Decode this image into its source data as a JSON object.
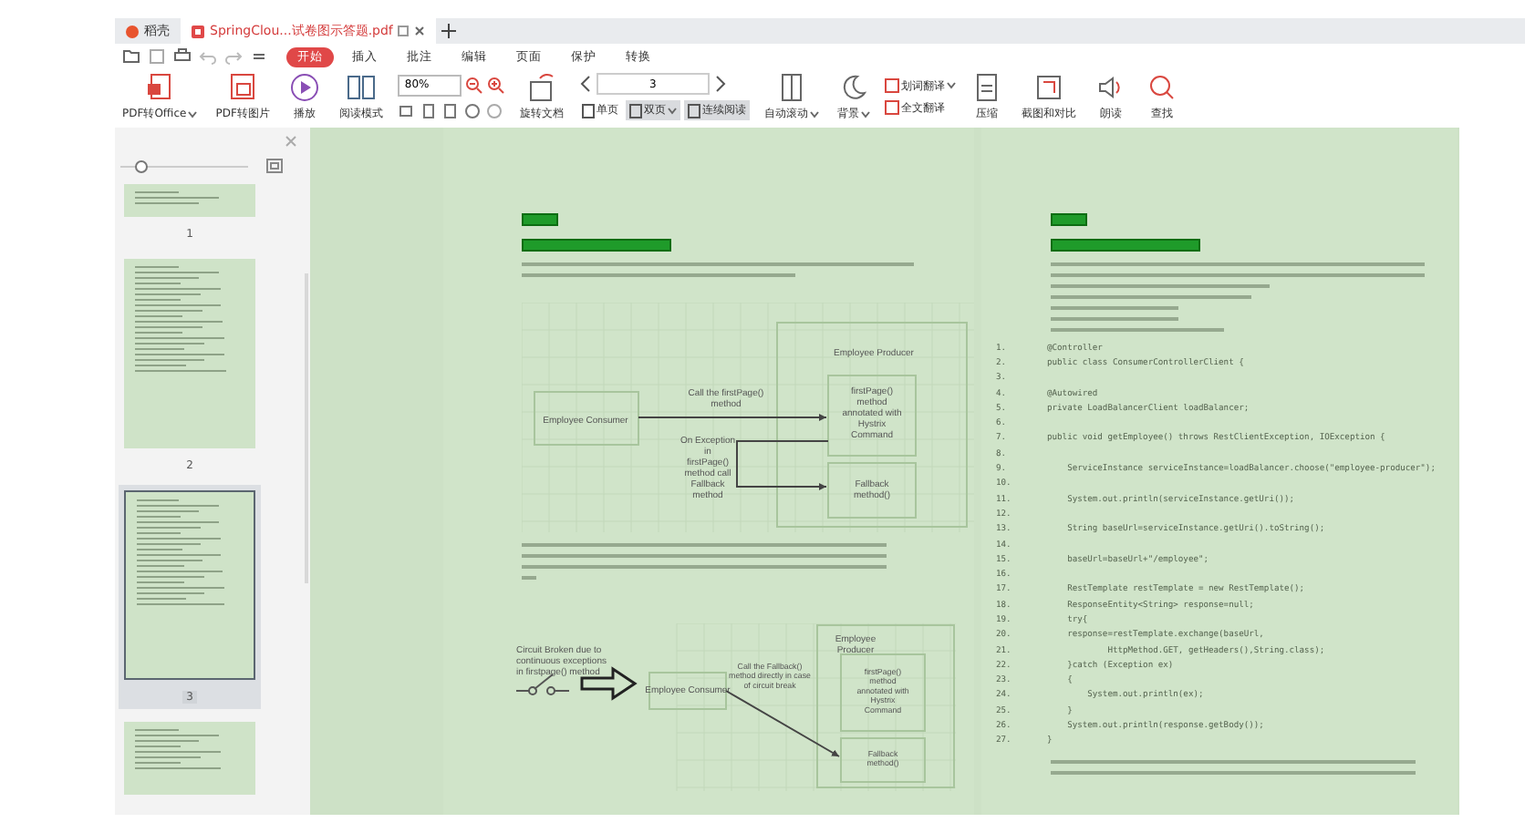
{
  "tabs": [
    {
      "label": "稻壳",
      "selected": false
    },
    {
      "label": "SpringClou...试卷图示答题.pdf",
      "selected": true
    }
  ],
  "menu": [
    {
      "label": "开始",
      "selected": true
    },
    {
      "label": "插入",
      "selected": false
    },
    {
      "label": "批注",
      "selected": false
    },
    {
      "label": "编辑",
      "selected": false
    },
    {
      "label": "页面",
      "selected": false
    },
    {
      "label": "保护",
      "selected": false
    },
    {
      "label": "转换",
      "selected": false
    }
  ],
  "toolbar": {
    "convert": [
      {
        "label": "PDF转Office",
        "dropdown": true
      },
      {
        "label": "PDF转图片",
        "dropdown": false
      }
    ],
    "view": [
      {
        "label": "播放"
      },
      {
        "label": "阅读模式"
      }
    ],
    "zoom": "80%",
    "rotate": "旋转文档",
    "page_input": "3",
    "page_modes": [
      {
        "label": "单页",
        "selected": false,
        "dropdown": false
      },
      {
        "label": "双页",
        "selected": true,
        "dropdown": true
      },
      {
        "label": "连续阅读",
        "selected": true,
        "dropdown": false
      }
    ],
    "autoscroll": {
      "label": "自动滚动",
      "dropdown": true
    },
    "background": {
      "label": "背景",
      "dropdown": true
    },
    "translate": [
      {
        "label": "划词翻译",
        "dropdown": true
      },
      {
        "label": "全文翻译",
        "dropdown": false
      }
    ],
    "more": [
      {
        "label": "压缩"
      },
      {
        "label": "截图和对比"
      },
      {
        "label": "朗读"
      },
      {
        "label": "查找"
      }
    ]
  },
  "sidebar": {
    "zoom": {
      "level": 0.15
    },
    "thumbnails": [
      {
        "label": "1",
        "selected": false
      },
      {
        "label": "2",
        "selected": false
      },
      {
        "label": "3",
        "selected": true
      },
      {
        "selected": false
      }
    ]
  },
  "diagram_1": {
    "producer_title": [
      "Employee Producer"
    ],
    "consumer": [
      "Employee Consumer"
    ],
    "primary_method": [
      "firstPage()",
      "method",
      "annotated with",
      "Hystrix",
      "Command"
    ],
    "fallback_method": [
      "Fallback",
      "method()"
    ],
    "call_label": [
      "Call the firstPage()",
      "method"
    ],
    "exception_label": [
      "On Exception",
      "in",
      "firstPage()",
      "method call",
      "Fallback",
      "method"
    ]
  },
  "diagram_2": {
    "breaker_label": [
      "Circuit Broken due to",
      "continuous exceptions",
      "in firstpage() method"
    ],
    "consumer": [
      "Employee Consumer"
    ],
    "direct_call_label": [
      "Call the Fallback()",
      "method directly in case",
      "of circuit break"
    ],
    "producer_title": [
      "Employee",
      "Producer"
    ],
    "primary_method": [
      "firstPage()",
      "method",
      "annotated with",
      "Hystrix",
      "Command"
    ],
    "fallback_method": [
      "Fallback",
      "method()"
    ]
  },
  "code": [
    {
      "number": "1.",
      "text": "@Controller"
    },
    {
      "number": "2.",
      "text": "public class ConsumerControllerClient {"
    },
    {
      "number": "3."
    },
    {
      "number": "4.",
      "text": "@Autowired"
    },
    {
      "number": "5.",
      "text": "private LoadBalancerClient loadBalancer;"
    },
    {
      "number": "6."
    },
    {
      "number": "7.",
      "text": "public void getEmployee() throws RestClientException, IOException {"
    },
    {
      "number": "8."
    },
    {
      "number": "9.",
      "text": "    ServiceInstance serviceInstance=loadBalancer.choose(\"employee-producer\");"
    },
    {
      "number": "10."
    },
    {
      "number": "11.",
      "text": "    System.out.println(serviceInstance.getUri());"
    },
    {
      "number": "12."
    },
    {
      "number": "13.",
      "text": "    String baseUrl=serviceInstance.getUri().toString();"
    },
    {
      "number": "14."
    },
    {
      "number": "15.",
      "text": "    baseUrl=baseUrl+\"/employee\";"
    },
    {
      "number": "16."
    },
    {
      "number": "17.",
      "text": "    RestTemplate restTemplate = new RestTemplate();"
    },
    {
      "number": "18.",
      "text": "    ResponseEntity<String> response=null;"
    },
    {
      "number": "19.",
      "text": "    try{"
    },
    {
      "number": "20.",
      "text": "    response=restTemplate.exchange(baseUrl,"
    },
    {
      "number": "21.",
      "text": "            HttpMethod.GET, getHeaders(),String.class);"
    },
    {
      "number": "22.",
      "text": "    }catch (Exception ex)"
    },
    {
      "number": "23.",
      "text": "    {"
    },
    {
      "number": "24.",
      "text": "        System.out.println(ex);"
    },
    {
      "number": "25.",
      "text": "    }"
    },
    {
      "number": "26.",
      "text": "    System.out.println(response.getBody());"
    },
    {
      "number": "27.",
      "text": "}"
    }
  ]
}
